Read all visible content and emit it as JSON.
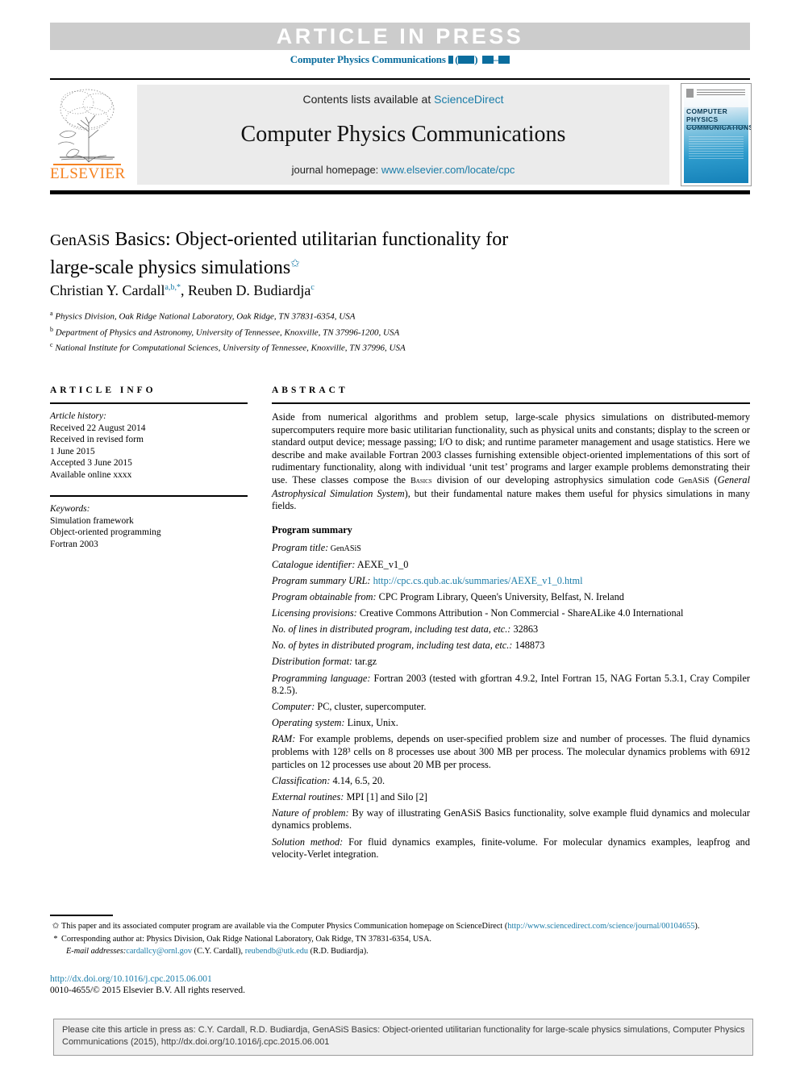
{
  "banner": {
    "article_in_press": "ARTICLE IN PRESS",
    "journal_reference_prefix": "Computer Physics Communications"
  },
  "masthead": {
    "contents_prefix": "Contents lists available at ",
    "contents_link": "ScienceDirect",
    "journal_title": "Computer Physics Communications",
    "homepage_prefix": "journal homepage: ",
    "homepage_url": "www.elsevier.com/locate/cpc",
    "publisher": "ELSEVIER",
    "cover_title_line1": "COMPUTER PHYSICS",
    "cover_title_line2": "COMMUNICATIONS"
  },
  "article": {
    "title_line1_sc": "GenASiS",
    "title_line1_rest": " Basics: Object-oriented utilitarian functionality for",
    "title_line2": "large-scale physics simulations",
    "title_footnote_mark": "✩",
    "authors": "Christian Y. Cardall",
    "author1_sup": "a,b,*",
    "authors2": ", Reuben D. Budiardja",
    "author2_sup": "c",
    "affiliations": [
      {
        "mark": "a",
        "text": "Physics Division, Oak Ridge National Laboratory, Oak Ridge, TN 37831-6354, USA"
      },
      {
        "mark": "b",
        "text": "Department of Physics and Astronomy, University of Tennessee, Knoxville, TN 37996-1200, USA"
      },
      {
        "mark": "c",
        "text": "National Institute for Computational Sciences, University of Tennessee, Knoxville, TN 37996, USA"
      }
    ]
  },
  "article_info": {
    "heading": "ARTICLE INFO",
    "history_label": "Article history:",
    "history": [
      "Received 22 August 2014",
      "Received in revised form",
      "1 June 2015",
      "Accepted 3 June 2015",
      "Available online xxxx"
    ],
    "keywords_label": "Keywords:",
    "keywords": [
      "Simulation framework",
      "Object-oriented programming",
      "Fortran 2003"
    ]
  },
  "abstract": {
    "heading": "ABSTRACT",
    "text_part1": "Aside from numerical algorithms and problem setup, large-scale physics simulations on distributed-memory supercomputers require more basic utilitarian functionality, such as physical units and constants; display to the screen or standard output device; message passing; I/O to disk; and runtime parameter management and usage statistics. Here we describe and make available Fortran 2003 classes furnishing extensible object-oriented implementations of this sort of rudimentary functionality, along with individual ‘unit test’ programs and larger example problems demonstrating their use. These classes compose the ",
    "basics_sc": "Basics",
    "text_part2": " division of our developing astrophysics simulation code ",
    "genasis_sc": "GenASiS",
    "text_part3": " (",
    "genasis_expansion": "General Astrophysical Simulation System",
    "text_part4": "), but their fundamental nature makes them useful for physics simulations in many fields."
  },
  "program_summary": {
    "heading": "Program summary",
    "entries": [
      {
        "label": "Program title:",
        "value": " GenASiS",
        "value_sc": true
      },
      {
        "label": "Catalogue identifier:",
        "value": " AEXE_v1_0"
      },
      {
        "label": "Program summary URL:",
        "value": " http://cpc.cs.qub.ac.uk/summaries/AEXE_v1_0.html",
        "link": true
      },
      {
        "label": "Program obtainable from:",
        "value": " CPC Program Library, Queen's University, Belfast, N. Ireland"
      },
      {
        "label": "Licensing provisions:",
        "value": " Creative Commons Attribution - Non Commercial - ShareALike 4.0 International"
      },
      {
        "label": "No. of lines in distributed program, including test data, etc.:",
        "value": " 32863"
      },
      {
        "label": "No. of bytes in distributed program, including test data, etc.:",
        "value": " 148873"
      },
      {
        "label": "Distribution format:",
        "value": " tar.gz"
      },
      {
        "label": "Programming language:",
        "value": " Fortran 2003 (tested with gfortran 4.9.2, Intel Fortran 15, NAG Fortan 5.3.1, Cray Compiler 8.2.5)."
      },
      {
        "label": "Computer:",
        "value": " PC, cluster, supercomputer."
      },
      {
        "label": "Operating system:",
        "value": " Linux, Unix."
      },
      {
        "label": "RAM:",
        "value": " For example problems, depends on user-specified problem size and number of processes. The fluid dynamics problems with 128³ cells on 8 processes use about 300 MB per process. The molecular dynamics problems with 6912 particles on 12 processes use about 20 MB per process."
      },
      {
        "label": "Classification:",
        "value": " 4.14, 6.5, 20."
      },
      {
        "label": "External routines:",
        "value": " MPI [1] and Silo [2]"
      },
      {
        "label": "Nature of problem:",
        "value": " By way of illustrating GenASiS Basics functionality, solve example fluid dynamics and molecular dynamics problems."
      },
      {
        "label": "Solution method:",
        "value": " For fluid dynamics examples, finite-volume. For molecular dynamics examples, leapfrog and velocity-Verlet integration."
      }
    ]
  },
  "footnotes": {
    "star_mark": "✩",
    "star_text_a": "This paper and its associated computer program are available via the Computer Physics Communication homepage on ScienceDirect  (",
    "star_link": "http://www.sciencedirect.com/science/journal/00104655",
    "star_text_b": ").",
    "asterisk_mark": "*",
    "asterisk_text": "Corresponding author at: Physics Division, Oak Ridge National Laboratory, Oak Ridge, TN 37831-6354, USA.",
    "email_label": "E-mail addresses:",
    "email1": "cardallcy@ornl.gov",
    "email1_owner": " (C.Y. Cardall), ",
    "email2": "reubendb@utk.edu",
    "email2_owner": " (R.D. Budiardja)."
  },
  "doi": "http://dx.doi.org/10.1016/j.cpc.2015.06.001",
  "copyright": "0010-4655/© 2015 Elsevier B.V. All rights reserved.",
  "cite_box": {
    "text": "Please cite this article in press as: C.Y. Cardall, R.D. Budiardja, GenASiS Basics: Object-oriented utilitarian functionality for large-scale physics simulations, Computer Physics Communications (2015), http://dx.doi.org/10.1016/j.cpc.2015.06.001"
  },
  "colors": {
    "link": "#1a7ca8",
    "journal_ref": "#0b6d9e",
    "elsevier_orange": "#f58220",
    "banner_bg": "#cccccc",
    "masthead_bg": "#ebebeb",
    "cite_bg": "#efefef"
  }
}
